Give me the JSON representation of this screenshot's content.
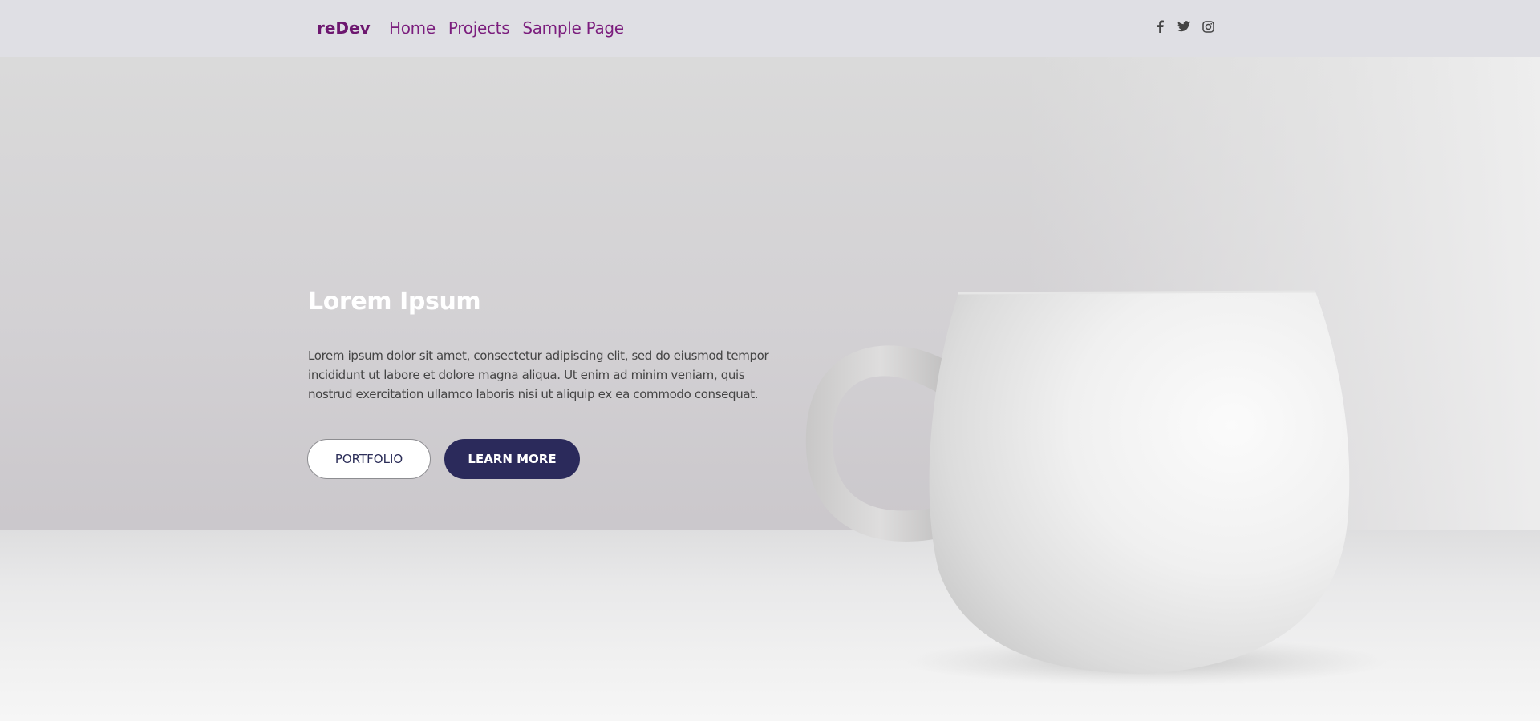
{
  "nav": {
    "brand": "reDev",
    "links": [
      "Home",
      "Projects",
      "Sample Page"
    ],
    "social_icons": [
      "facebook-icon",
      "twitter-icon",
      "instagram-icon"
    ]
  },
  "hero": {
    "title": "Lorem Ipsum",
    "text": "Lorem ipsum dolor sit amet, consectetur adipiscing elit, sed do eiusmod tempor incididunt ut labore et dolore magna aliqua. Ut enim ad minim veniam, quis nostrud exercitation ullamco laboris nisi ut aliquip ex ea commodo consequat.",
    "buttons": {
      "portfolio": "PORTFOLIO",
      "learn_more": "LEARN MORE"
    }
  },
  "colors": {
    "brand": "#6d176f",
    "nav_link": "#7b1d7d",
    "navbar_bg": "#dfdfe4",
    "button_dark": "#2b2a5b"
  }
}
